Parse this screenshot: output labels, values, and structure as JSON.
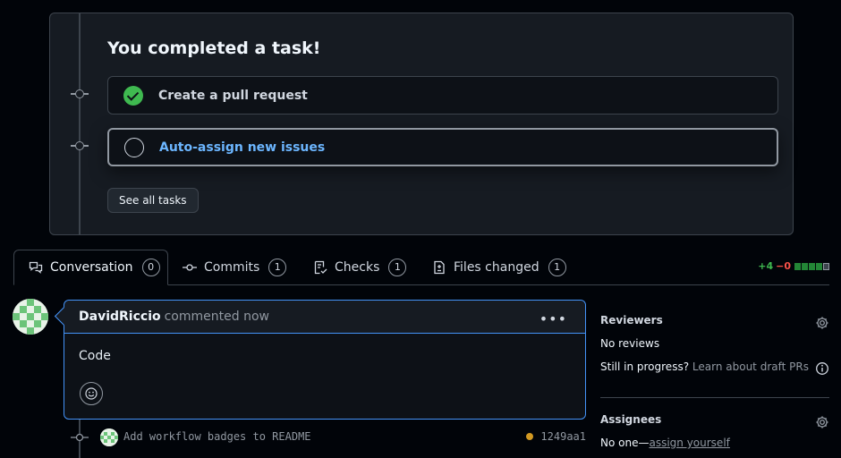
{
  "task_card": {
    "title": "You completed a task!",
    "tasks": [
      {
        "label": "Create a pull request",
        "state": "done"
      },
      {
        "label": "Auto-assign new issues",
        "state": "open"
      }
    ],
    "see_all_label": "See all tasks"
  },
  "tabs": [
    {
      "label": "Conversation",
      "count": "0",
      "icon": "comment-discussion-icon"
    },
    {
      "label": "Commits",
      "count": "1",
      "icon": "git-commit-icon"
    },
    {
      "label": "Checks",
      "count": "1",
      "icon": "checklist-icon"
    },
    {
      "label": "Files changed",
      "count": "1",
      "icon": "file-diff-icon"
    }
  ],
  "diffstat": {
    "additions": "+4",
    "deletions": "−0"
  },
  "comment": {
    "author": "DavidRiccio",
    "action": "commented now",
    "body": "Code"
  },
  "commit": {
    "message": "Add workflow badges to README",
    "sha": "1249aa1",
    "status_color": "#d29922"
  },
  "sidebar": {
    "reviewers": {
      "title": "Reviewers",
      "value": "No reviews",
      "draft_prefix": "Still in progress?",
      "draft_link": "Learn about draft PRs"
    },
    "assignees": {
      "title": "Assignees",
      "value": "No one—",
      "link": "assign yourself"
    }
  },
  "colors": {
    "accent": "#4493f8",
    "success": "#3fb950",
    "link": "#6cb6ff"
  }
}
